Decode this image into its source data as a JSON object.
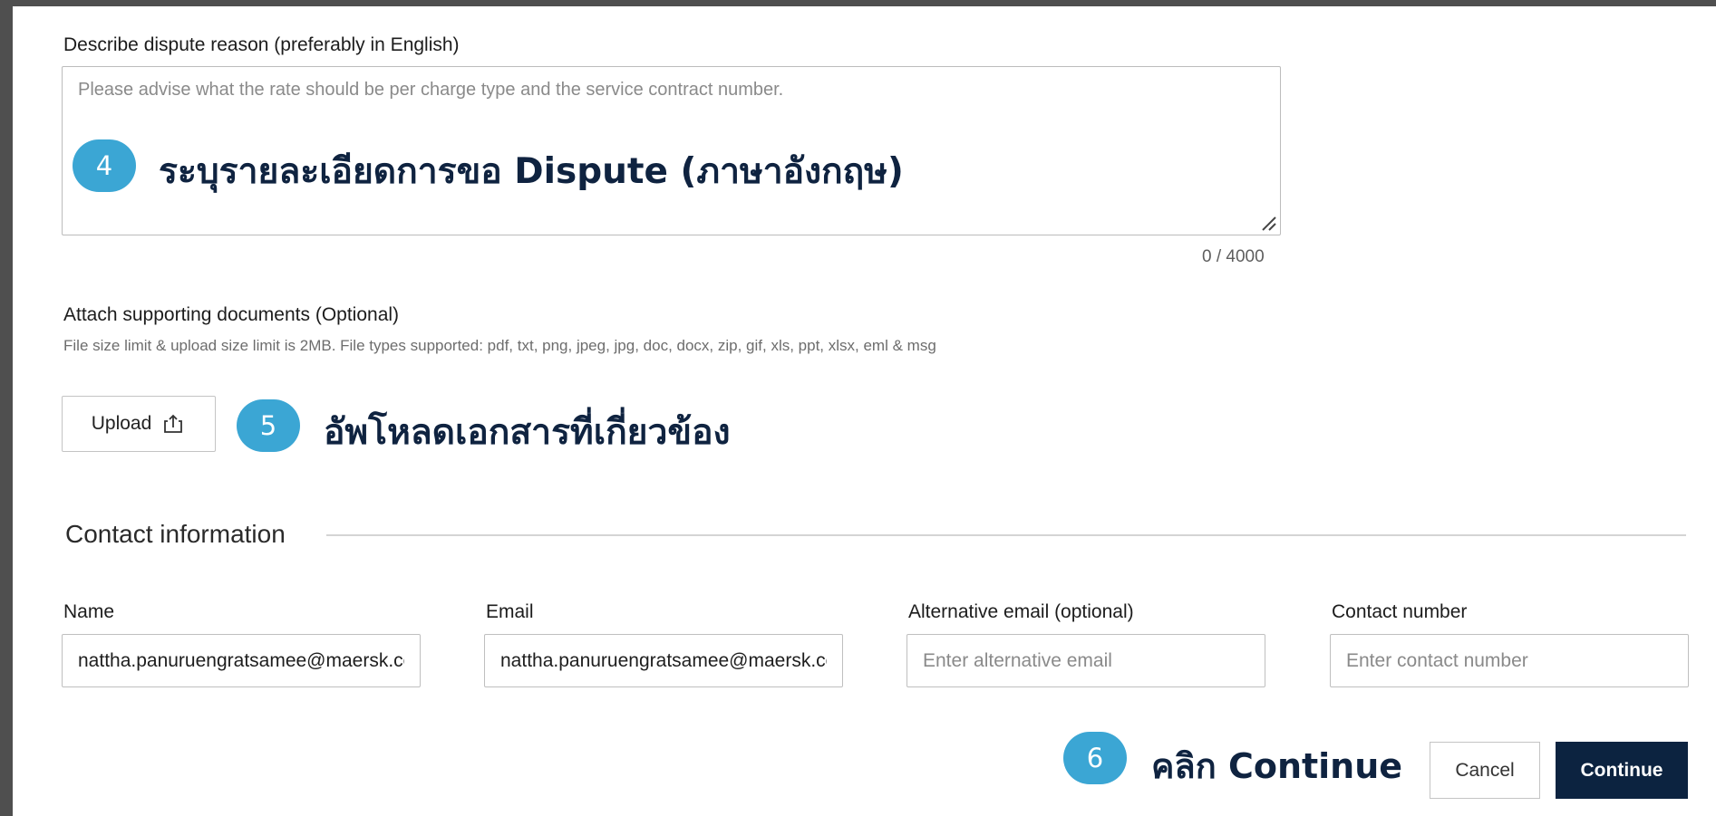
{
  "dispute_reason": {
    "label": "Describe dispute reason (preferably in English)",
    "placeholder": "Please advise what the rate should be per charge type and the service contract number.",
    "value": "",
    "counter": "0 / 4000"
  },
  "attachments": {
    "label": "Attach supporting documents (Optional)",
    "hint": "File size limit & upload size limit is 2MB. File types supported: pdf, txt, png, jpeg, jpg, doc, docx, zip, gif, xls, ppt, xlsx, eml & msg",
    "upload_label": "Upload",
    "upload_icon": "upload-icon"
  },
  "contact": {
    "section_title": "Contact information",
    "name_label": "Name",
    "name_value": "nattha.panuruengratsamee@maersk.com",
    "email_label": "Email",
    "email_value": "nattha.panuruengratsamee@maersk.com",
    "alt_email_label": "Alternative email (optional)",
    "alt_email_placeholder": "Enter alternative email",
    "phone_label": "Contact number",
    "phone_placeholder": "Enter contact number"
  },
  "actions": {
    "cancel_label": "Cancel",
    "continue_label": "Continue"
  },
  "annotations": [
    {
      "number": "4",
      "text": "ระบุรายละเอียดการขอ Dispute (ภาษาอังกฤษ)"
    },
    {
      "number": "5",
      "text": "อัพโหลดเอกสารที่เกี่ยวข้อง"
    },
    {
      "number": "6",
      "text": "คลิก Continue"
    }
  ],
  "colors": {
    "badge": "#3ba6d4",
    "annotation_text": "#0f2340",
    "primary_button": "#0c2340",
    "frame": "#4f4f4f"
  }
}
